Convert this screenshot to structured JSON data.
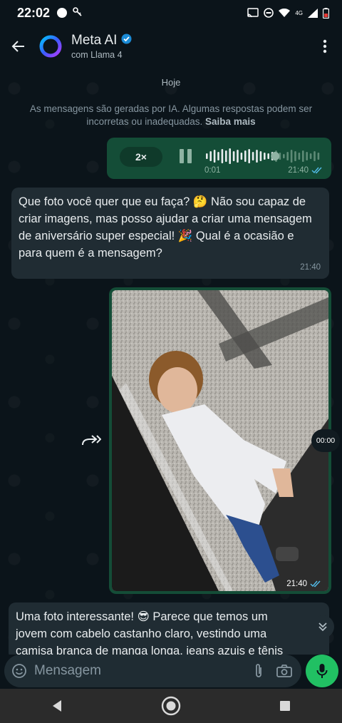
{
  "status_bar": {
    "time": "22:02",
    "network": "4G",
    "icons": [
      "notification-dot-icon",
      "key-icon",
      "cast-icon",
      "do-not-disturb-icon",
      "wifi-icon",
      "signal-icon",
      "battery-icon"
    ]
  },
  "header": {
    "title": "Meta AI",
    "subtitle": "com Llama 4",
    "verified": true,
    "accent": "#1b8bd6"
  },
  "chat": {
    "date_label": "Hoje",
    "notice_text": "As mensagens são geradas por IA. Algumas respostas podem ser incorretas ou inadequadas.",
    "notice_link": "Saiba mais",
    "voice_message": {
      "speed": "2×",
      "duration": "0:01",
      "time": "21:40",
      "progress": 0.6,
      "status": "read"
    },
    "ai_message_1": {
      "text": "Que foto você quer que eu faça? 🤔 Não sou capaz de criar imagens, mas posso ajudar a criar uma mensagem de aniversário super especial! 🎉 Qual é a ocasião e para quem é a mensagem?",
      "time": "21:40"
    },
    "video_message": {
      "duration": "00:00",
      "time": "21:40",
      "status": "read"
    },
    "ai_message_2": {
      "text": "Uma foto interessante! 😎 Parece que temos um jovem com cabelo castanho claro, vestindo uma camisa branca de manga longa, jeans azuis e tênis"
    }
  },
  "composer": {
    "placeholder": "Mensagem"
  },
  "colors": {
    "outgoing_bubble": "#144d37",
    "incoming_bubble": "#202c33",
    "background": "#0b141a",
    "mic_button": "#21c063",
    "read_ticks": "#53bdeb"
  }
}
